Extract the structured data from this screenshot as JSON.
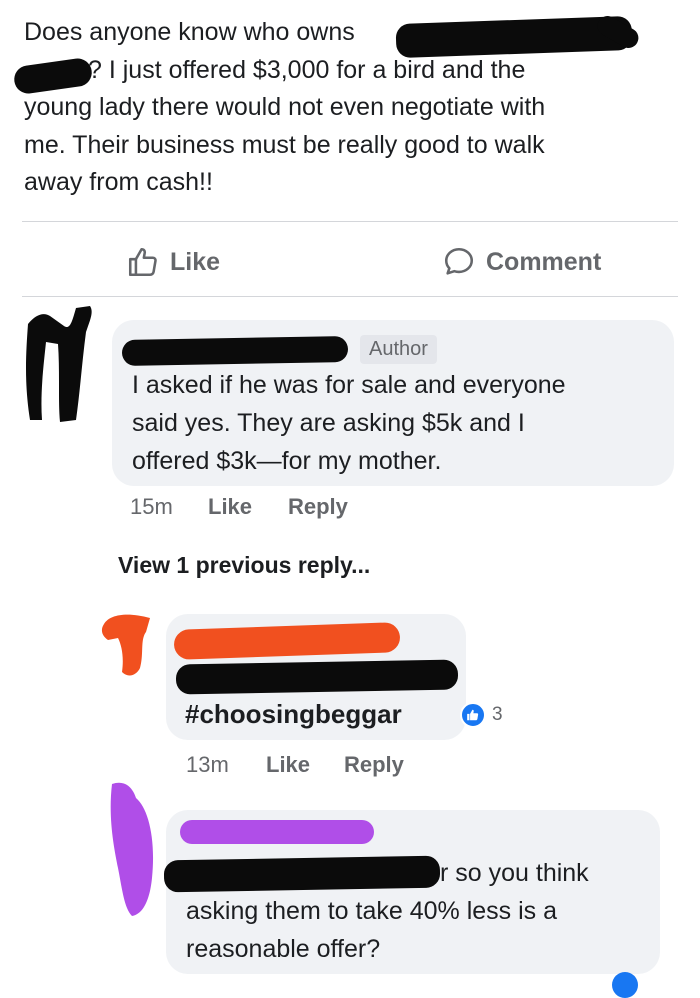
{
  "post": {
    "text_lines": [
      "Does anyone know who owns",
      "? I just offered $3,000 for a bird and the",
      "young lady there would not even negotiate with",
      "me. Their business must be really good to walk",
      "away from cash!!"
    ]
  },
  "actions": {
    "like_label": "Like",
    "comment_label": "Comment"
  },
  "comments": [
    {
      "badge": "Author",
      "lines": [
        "I asked if he was for sale and everyone",
        "said yes. They are asking $5k and I",
        "offered $3k—for my mother."
      ],
      "time": "15m",
      "like": "Like",
      "reply": "Reply"
    },
    {
      "view_previous": "View 1 previous reply...",
      "hashtag": "#choosingbeggar",
      "reaction_count": "3",
      "time": "13m",
      "like": "Like",
      "reply": "Reply"
    },
    {
      "lines": [
        "r so you think",
        "asking them to take 40% less is a",
        "reasonable offer?"
      ]
    }
  ],
  "colors": {
    "redaction_black": "#0b0b0b",
    "redaction_orange": "#f1501f",
    "redaction_purple": "#b04ee8",
    "bubble_bg": "#f0f2f5",
    "meta_gray": "#65676b",
    "like_blue": "#1877f2"
  }
}
